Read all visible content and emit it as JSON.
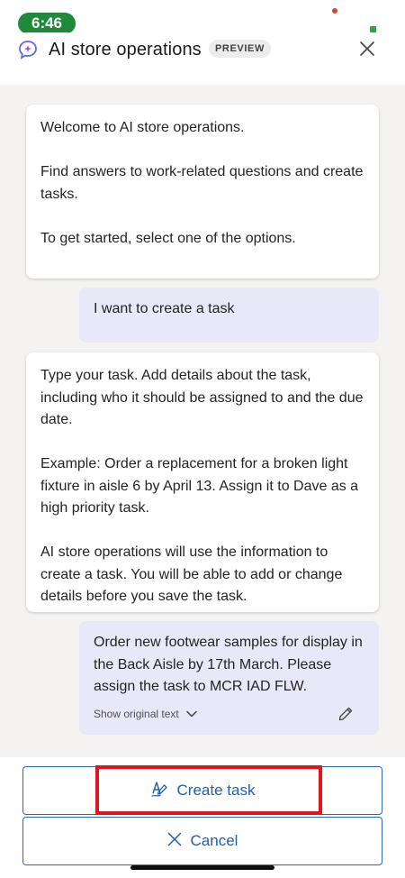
{
  "status_bar": {
    "time": "6:46"
  },
  "header": {
    "title": "AI store operations",
    "badge": "PREVIEW",
    "app_icon": "copilot-sparkle-icon",
    "close_icon": "close-icon"
  },
  "messages": {
    "welcome": {
      "p1": "Welcome to AI store operations.",
      "p2": "Find answers to work-related questions and create tasks.",
      "p3": "To get started, select one of the options."
    },
    "user1": {
      "text": "I want to create a task"
    },
    "instructions": {
      "p1": "Type your task. Add details about the task, including who it should be assigned to and the due date.",
      "p2": "Example: Order a replacement for a broken light fixture in aisle 6 by April 13. Assign it to Dave as a high priority task.",
      "p3": "AI store operations will use the information to create a task. You will be able to add or change details before you save the task."
    },
    "user2": {
      "text": "Order new footwear samples for display in the Back Aisle by 17th March. Please assign the task to MCR IAD FLW.",
      "show_original": "Show original text"
    }
  },
  "actions": {
    "create_task": "Create task",
    "cancel": "Cancel"
  },
  "colors": {
    "accent": "#1d5fb3",
    "highlight": "#e2131c",
    "user_bubble": "#e8e8f8",
    "chat_bg": "#f4f3f1",
    "time_pill": "#1f8b3a"
  }
}
